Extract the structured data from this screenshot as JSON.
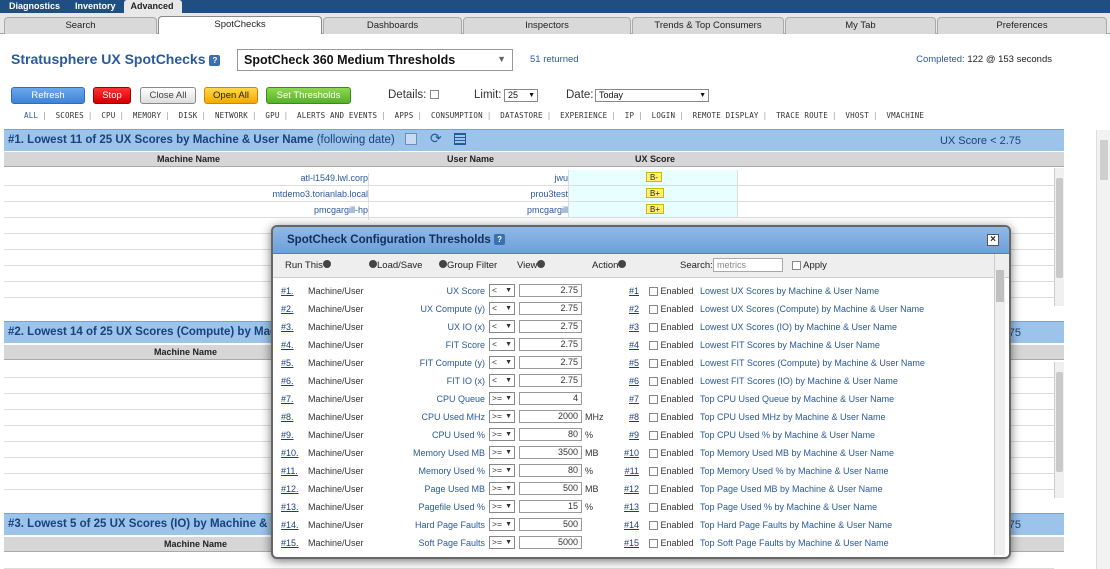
{
  "topnav": [
    "Diagnostics",
    "Inventory",
    "Advanced"
  ],
  "tabs": [
    "Search",
    "SpotChecks",
    "Dashboards",
    "Inspectors",
    "Trends & Top Consumers",
    "My Tab",
    "Preferences"
  ],
  "header": {
    "title": "Stratusphere UX SpotChecks",
    "help": "?",
    "select": "SpotCheck 360 Medium Thresholds",
    "returned": "51 returned",
    "completed_label": "Completed:",
    "completed_value": "122 @ 153 seconds"
  },
  "toolbar": {
    "refresh": "Refresh",
    "stop": "Stop",
    "close_all": "Close All",
    "open_all": "Open All",
    "set_thresholds": "Set Thresholds",
    "details": "Details:",
    "limit_label": "Limit:",
    "limit_value": "25",
    "date_label": "Date:",
    "date_value": "Today"
  },
  "categories": [
    "ALL",
    "SCORES",
    "CPU",
    "MEMORY",
    "DISK",
    "NETWORK",
    "GPU",
    "ALERTS AND EVENTS",
    "APPS",
    "CONSUMPTION",
    "DATASTORE",
    "EXPERIENCE",
    "IP",
    "LOGIN",
    "REMOTE DISPLAY",
    "TRACE ROUTE",
    "VHOST",
    "VMACHINE"
  ],
  "sections": [
    {
      "title": "#1. Lowest 11 of 25 UX Scores by Machine & User Name",
      "suffix": "(following date)",
      "right": "UX Score < 2.75",
      "cols": [
        "Machine Name",
        "User Name",
        "UX Score"
      ],
      "rows": [
        [
          "atl-l1549.lwl.corp",
          "jwu",
          "B-"
        ],
        [
          "mtdemo3.torianlab.local",
          "prou3test",
          "B+"
        ],
        [
          "pmcgargill-hp",
          "pmcgargill",
          "B+"
        ]
      ]
    },
    {
      "title": "#2. Lowest 14 of 25 UX Scores (Compute) by Mac",
      "right": "< 2.75",
      "cols": [
        "Machine Name"
      ]
    },
    {
      "title": "#3. Lowest 5 of 25 UX Scores (IO) by Machine & U",
      "right": "< 2.75",
      "cols": [
        "Machine Name"
      ]
    }
  ],
  "modal": {
    "title": "SpotCheck Configuration Thresholds",
    "help": "?",
    "close": "×",
    "toolbar": {
      "run_this": "Run This",
      "load_save": "Load/Save",
      "group_filter": "Group Filter",
      "view": "View",
      "action": "Action",
      "search_label": "Search:",
      "search_placeholder": "metrics",
      "apply": "Apply"
    },
    "enabled_label": "Enabled",
    "rows": [
      {
        "num": "#1.",
        "group": "Machine/User",
        "metric": "UX Score",
        "op": "<",
        "value": "2.75",
        "unit": "",
        "num2": "#1",
        "desc": "Lowest UX Scores by Machine & User Name"
      },
      {
        "num": "#2.",
        "group": "Machine/User",
        "metric": "UX Compute (y)",
        "op": "<",
        "value": "2.75",
        "unit": "",
        "num2": "#2",
        "desc": "Lowest UX Scores (Compute) by Machine & User Name"
      },
      {
        "num": "#3.",
        "group": "Machine/User",
        "metric": "UX IO (x)",
        "op": "<",
        "value": "2.75",
        "unit": "",
        "num2": "#3",
        "desc": "Lowest UX Scores (IO) by Machine & User Name"
      },
      {
        "num": "#4.",
        "group": "Machine/User",
        "metric": "FIT Score",
        "op": "<",
        "value": "2.75",
        "unit": "",
        "num2": "#4",
        "desc": "Lowest FIT Scores by Machine & User Name"
      },
      {
        "num": "#5.",
        "group": "Machine/User",
        "metric": "FIT Compute (y)",
        "op": "<",
        "value": "2.75",
        "unit": "",
        "num2": "#5",
        "desc": "Lowest FIT Scores (Compute) by Machine & User Name"
      },
      {
        "num": "#6.",
        "group": "Machine/User",
        "metric": "FIT IO (x)",
        "op": "<",
        "value": "2.75",
        "unit": "",
        "num2": "#6",
        "desc": "Lowest FIT Scores (IO) by Machine & User Name"
      },
      {
        "num": "#7.",
        "group": "Machine/User",
        "metric": "CPU Queue",
        "op": ">=",
        "value": "4",
        "unit": "",
        "num2": "#7",
        "desc": "Top CPU Used Queue by Machine & User Name"
      },
      {
        "num": "#8.",
        "group": "Machine/User",
        "metric": "CPU Used MHz",
        "op": ">=",
        "value": "2000",
        "unit": "MHz",
        "num2": "#8",
        "desc": "Top CPU Used MHz by Machine & User Name"
      },
      {
        "num": "#9.",
        "group": "Machine/User",
        "metric": "CPU Used %",
        "op": ">=",
        "value": "80",
        "unit": "%",
        "num2": "#9",
        "desc": "Top CPU Used % by Machine & User Name"
      },
      {
        "num": "#10.",
        "group": "Machine/User",
        "metric": "Memory Used MB",
        "op": ">=",
        "value": "3500",
        "unit": "MB",
        "num2": "#10",
        "desc": "Top Memory Used MB by Machine & User Name"
      },
      {
        "num": "#11.",
        "group": "Machine/User",
        "metric": "Memory Used %",
        "op": ">=",
        "value": "80",
        "unit": "%",
        "num2": "#11",
        "desc": "Top Memory Used % by Machine & User Name"
      },
      {
        "num": "#12.",
        "group": "Machine/User",
        "metric": "Page Used MB",
        "op": ">=",
        "value": "500",
        "unit": "MB",
        "num2": "#12",
        "desc": "Top Page Used MB by Machine & User Name"
      },
      {
        "num": "#13.",
        "group": "Machine/User",
        "metric": "Pagefile Used %",
        "op": ">=",
        "value": "15",
        "unit": "%",
        "num2": "#13",
        "desc": "Top Page Used % by Machine & User Name"
      },
      {
        "num": "#14.",
        "group": "Machine/User",
        "metric": "Hard Page Faults",
        "op": ">=",
        "value": "500",
        "unit": "",
        "num2": "#14",
        "desc": "Top Hard Page Faults by Machine & User Name"
      },
      {
        "num": "#15.",
        "group": "Machine/User",
        "metric": "Soft Page Faults",
        "op": ">=",
        "value": "5000",
        "unit": "",
        "num2": "#15",
        "desc": "Top Soft Page Faults by Machine & User Name"
      }
    ]
  }
}
